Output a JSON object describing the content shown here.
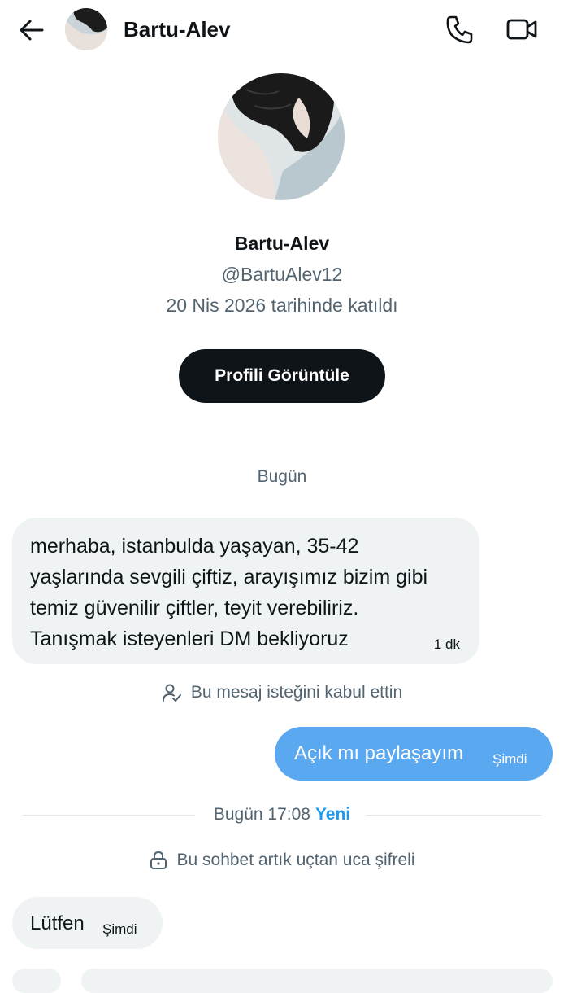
{
  "header": {
    "name": "Bartu-Alev"
  },
  "profile": {
    "name": "Bartu-Alev",
    "handle": "@BartuAlev12",
    "joined": "20 Nis 2026 tarihinde katıldı",
    "view_button_label": "Profili Görüntüle"
  },
  "conversation": {
    "day_label": "Bugün",
    "incoming_message": {
      "text": "merhaba, istanbulda yaşayan, 35-42\nyaşlarında sevgili çiftiz, arayışımız bizim gibi\ntemiz güvenilir çiftler, teyit verebiliriz.\nTanışmak isteyenleri DM bekliyoruz",
      "time": "1 dk"
    },
    "accepted_notice": "Bu mesaj isteğini kabul ettin",
    "outgoing_message": {
      "text": "Açık mı paylaşayım",
      "time": "Şimdi"
    },
    "divider": {
      "time_label": "Bugün 17:08",
      "new_label": "Yeni"
    },
    "encryption_notice": "Bu sohbet artık uçtan uca şifreli",
    "incoming_message_2": {
      "text": "Lütfen",
      "time": "Şimdi"
    }
  },
  "colors": {
    "accent": "#1d9bf0",
    "outgoing_bubble": "#5aa8f0",
    "incoming_bubble": "#eff3f4",
    "text_primary": "#0f1419",
    "text_secondary": "#536471"
  }
}
